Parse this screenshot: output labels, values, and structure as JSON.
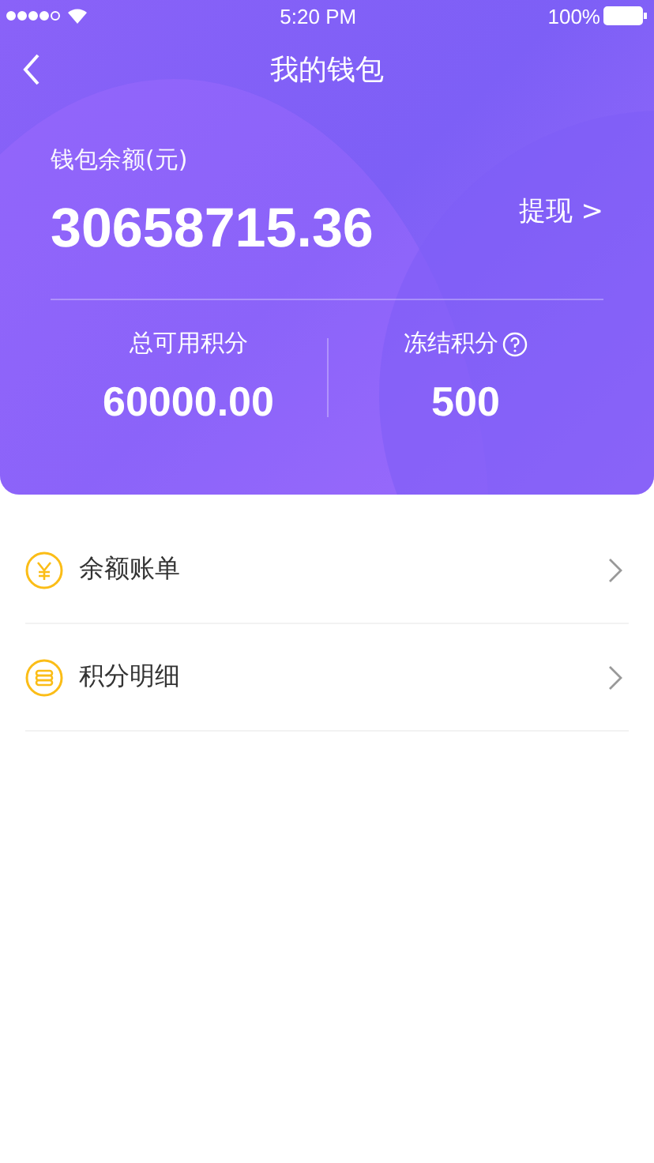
{
  "status_bar": {
    "time": "5:20 PM",
    "battery": "100%"
  },
  "nav": {
    "title": "我的钱包"
  },
  "wallet": {
    "balance_label": "钱包余额(元)",
    "balance": "30658715.36",
    "withdraw": "提现 >",
    "stats": [
      {
        "label": "总可用积分",
        "value": "60000.00",
        "help": false
      },
      {
        "label": "冻结积分",
        "value": "500",
        "help": true
      }
    ]
  },
  "menu": [
    {
      "kind": "yen",
      "label": "余额账单"
    },
    {
      "kind": "coins",
      "label": "积分明细"
    }
  ]
}
